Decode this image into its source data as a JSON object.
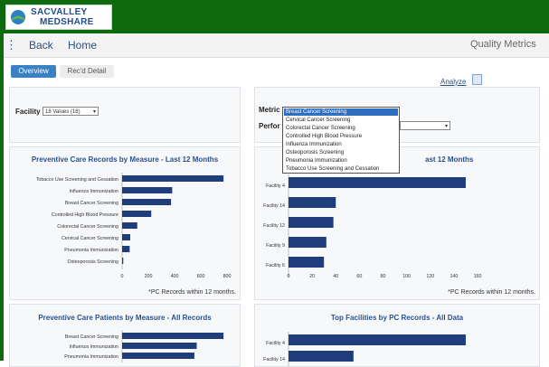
{
  "header": {
    "logo_line1": "SACVALLEY",
    "logo_line2": "MEDSHARE"
  },
  "nav": {
    "back_label": "Back",
    "home_label": "Home",
    "app_title": "Quality Metrics"
  },
  "tabs": [
    {
      "label": "Overview"
    },
    {
      "label": "Rec'd Detail"
    }
  ],
  "analyze_label": "Analyze",
  "filters": {
    "facility_label": "Facility",
    "facility_value": "18 Values (18)",
    "metric_label": "Metric",
    "perf_label": "Perfor",
    "metric_options": [
      "Breast Cancer Screening",
      "Cervical Cancer Screening",
      "Colorectal Cancer Screening",
      "Controlled High Blood Pressure",
      "Influenza Immunization",
      "Osteoporosis Screening",
      "Pneumonia Immunization",
      "Tobacco Use Screening and Cessation"
    ],
    "metric_selected_index": 0
  },
  "chart_data": [
    {
      "type": "bar",
      "orientation": "horizontal",
      "title": "Preventive Care Records by Measure - Last 12 Months",
      "categories": [
        "Tobacco Use Screening and Cessation",
        "Influenza Immunization",
        "Breast Cancer Screening",
        "Controlled High Blood Pressure",
        "Colorectal Cancer Screening",
        "Cervical Cancer Screening",
        "Pneumonia Immunization",
        "Osteoporosis Screening"
      ],
      "values": [
        870,
        430,
        420,
        250,
        130,
        70,
        65,
        10
      ],
      "xlim": [
        0,
        900
      ],
      "xticks": [
        "0",
        "200",
        "400",
        "600",
        "800"
      ],
      "footnote": "*PC Records within 12 months.",
      "color": "#1f3d7a"
    },
    {
      "type": "bar",
      "orientation": "horizontal",
      "title_visible": "ast 12 Months",
      "categories": [
        "Facility 4",
        "Facility 14",
        "Facility 12",
        "Facility 9",
        "Facility 6"
      ],
      "values": [
        150,
        40,
        38,
        32,
        30
      ],
      "xlim": [
        0,
        160
      ],
      "xticks": [
        "0",
        "20",
        "40",
        "60",
        "80",
        "100",
        "120",
        "140",
        "160"
      ],
      "footnote": "*PC Records within 12 months.",
      "color": "#1f3d7a"
    },
    {
      "type": "bar",
      "orientation": "horizontal",
      "title": "Preventive Care Patients by Measure - All Records",
      "categories": [
        "Breast Cancer Screening",
        "Influenza Immunization",
        "Pneumonia Immunization"
      ],
      "values": [
        870,
        640,
        620
      ],
      "xlim": [
        0,
        900
      ],
      "color": "#1f3d7a"
    },
    {
      "type": "bar",
      "orientation": "horizontal",
      "title": "Top Facilities by PC Records - All Data",
      "categories": [
        "Facility 4",
        "Facility 14"
      ],
      "values": [
        150,
        55
      ],
      "xlim": [
        0,
        160
      ],
      "color": "#1f3d7a"
    }
  ]
}
